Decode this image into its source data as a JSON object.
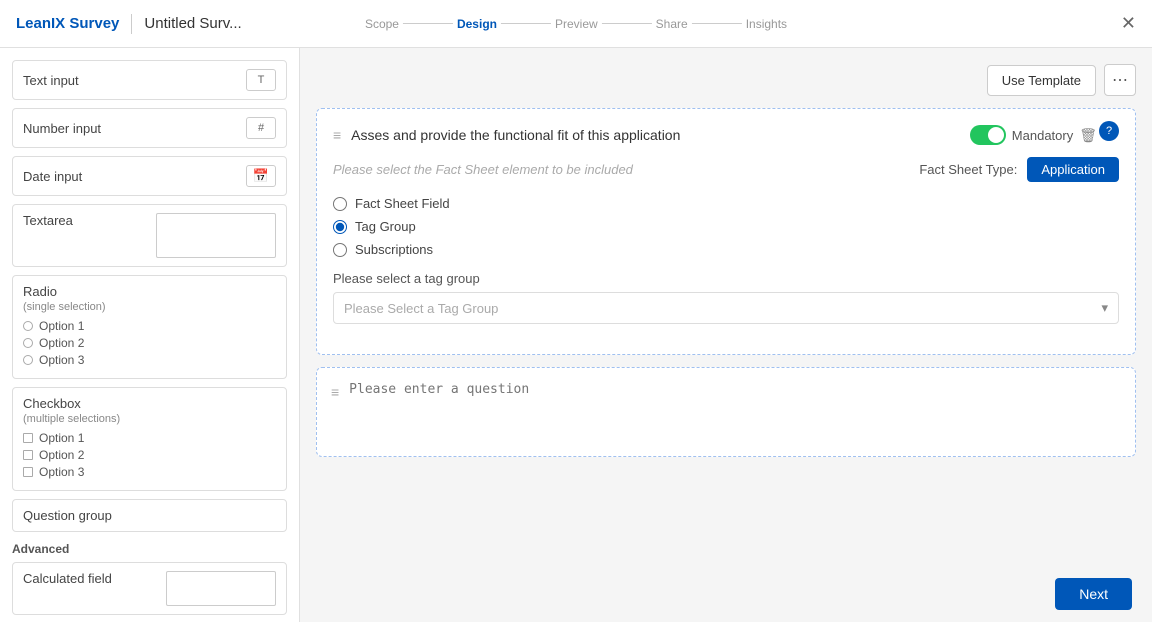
{
  "header": {
    "logo": "LeanIX Survey",
    "divider": "|",
    "title": "Untitled Surv...",
    "steps": [
      {
        "label": "Scope",
        "active": false
      },
      {
        "label": "Design",
        "active": true
      },
      {
        "label": "Preview",
        "active": false
      },
      {
        "label": "Share",
        "active": false
      },
      {
        "label": "Insights",
        "active": false
      }
    ],
    "close_icon": "✕"
  },
  "toolbar": {
    "use_template_label": "Use Template",
    "more_icon": "⋯"
  },
  "sidebar": {
    "items": [
      {
        "label": "Text input",
        "icon": "T"
      },
      {
        "label": "Number input",
        "icon": "#"
      },
      {
        "label": "Date input",
        "icon": "📅"
      },
      {
        "label": "Textarea",
        "icon": ""
      },
      {
        "label": "Radio",
        "sub": "(single selection)",
        "options": [
          "Option 1",
          "Option 2",
          "Option 3"
        ]
      },
      {
        "label": "Checkbox",
        "sub": "(multiple selections)",
        "options": [
          "Option 1",
          "Option 2",
          "Option 3"
        ]
      },
      {
        "label": "Question group"
      }
    ],
    "advanced_label": "Advanced",
    "advanced_items": [
      {
        "label": "Calculated field"
      }
    ]
  },
  "question_card": {
    "drag_handle": "≡",
    "title": "Asses and provide the functional fit of this application",
    "mandatory_label": "Mandatory",
    "fact_sheet_placeholder": "Please select the Fact Sheet element to be included",
    "fact_sheet_type_label": "Fact Sheet Type:",
    "fact_sheet_type_value": "Application",
    "element_options": [
      {
        "label": "Fact Sheet Field",
        "value": "fact_sheet_field",
        "checked": false
      },
      {
        "label": "Tag Group",
        "value": "tag_group",
        "checked": true
      },
      {
        "label": "Subscriptions",
        "value": "subscriptions",
        "checked": false
      }
    ],
    "tag_group_label": "Please select a tag group",
    "tag_group_placeholder": "Please Select a Tag Group",
    "help_icon": "?",
    "delete_icon": "🗑",
    "more_icon": "⋯"
  },
  "add_question": {
    "drag_handle": "≡",
    "placeholder": "Please enter a question"
  },
  "footer": {
    "next_label": "Next"
  }
}
